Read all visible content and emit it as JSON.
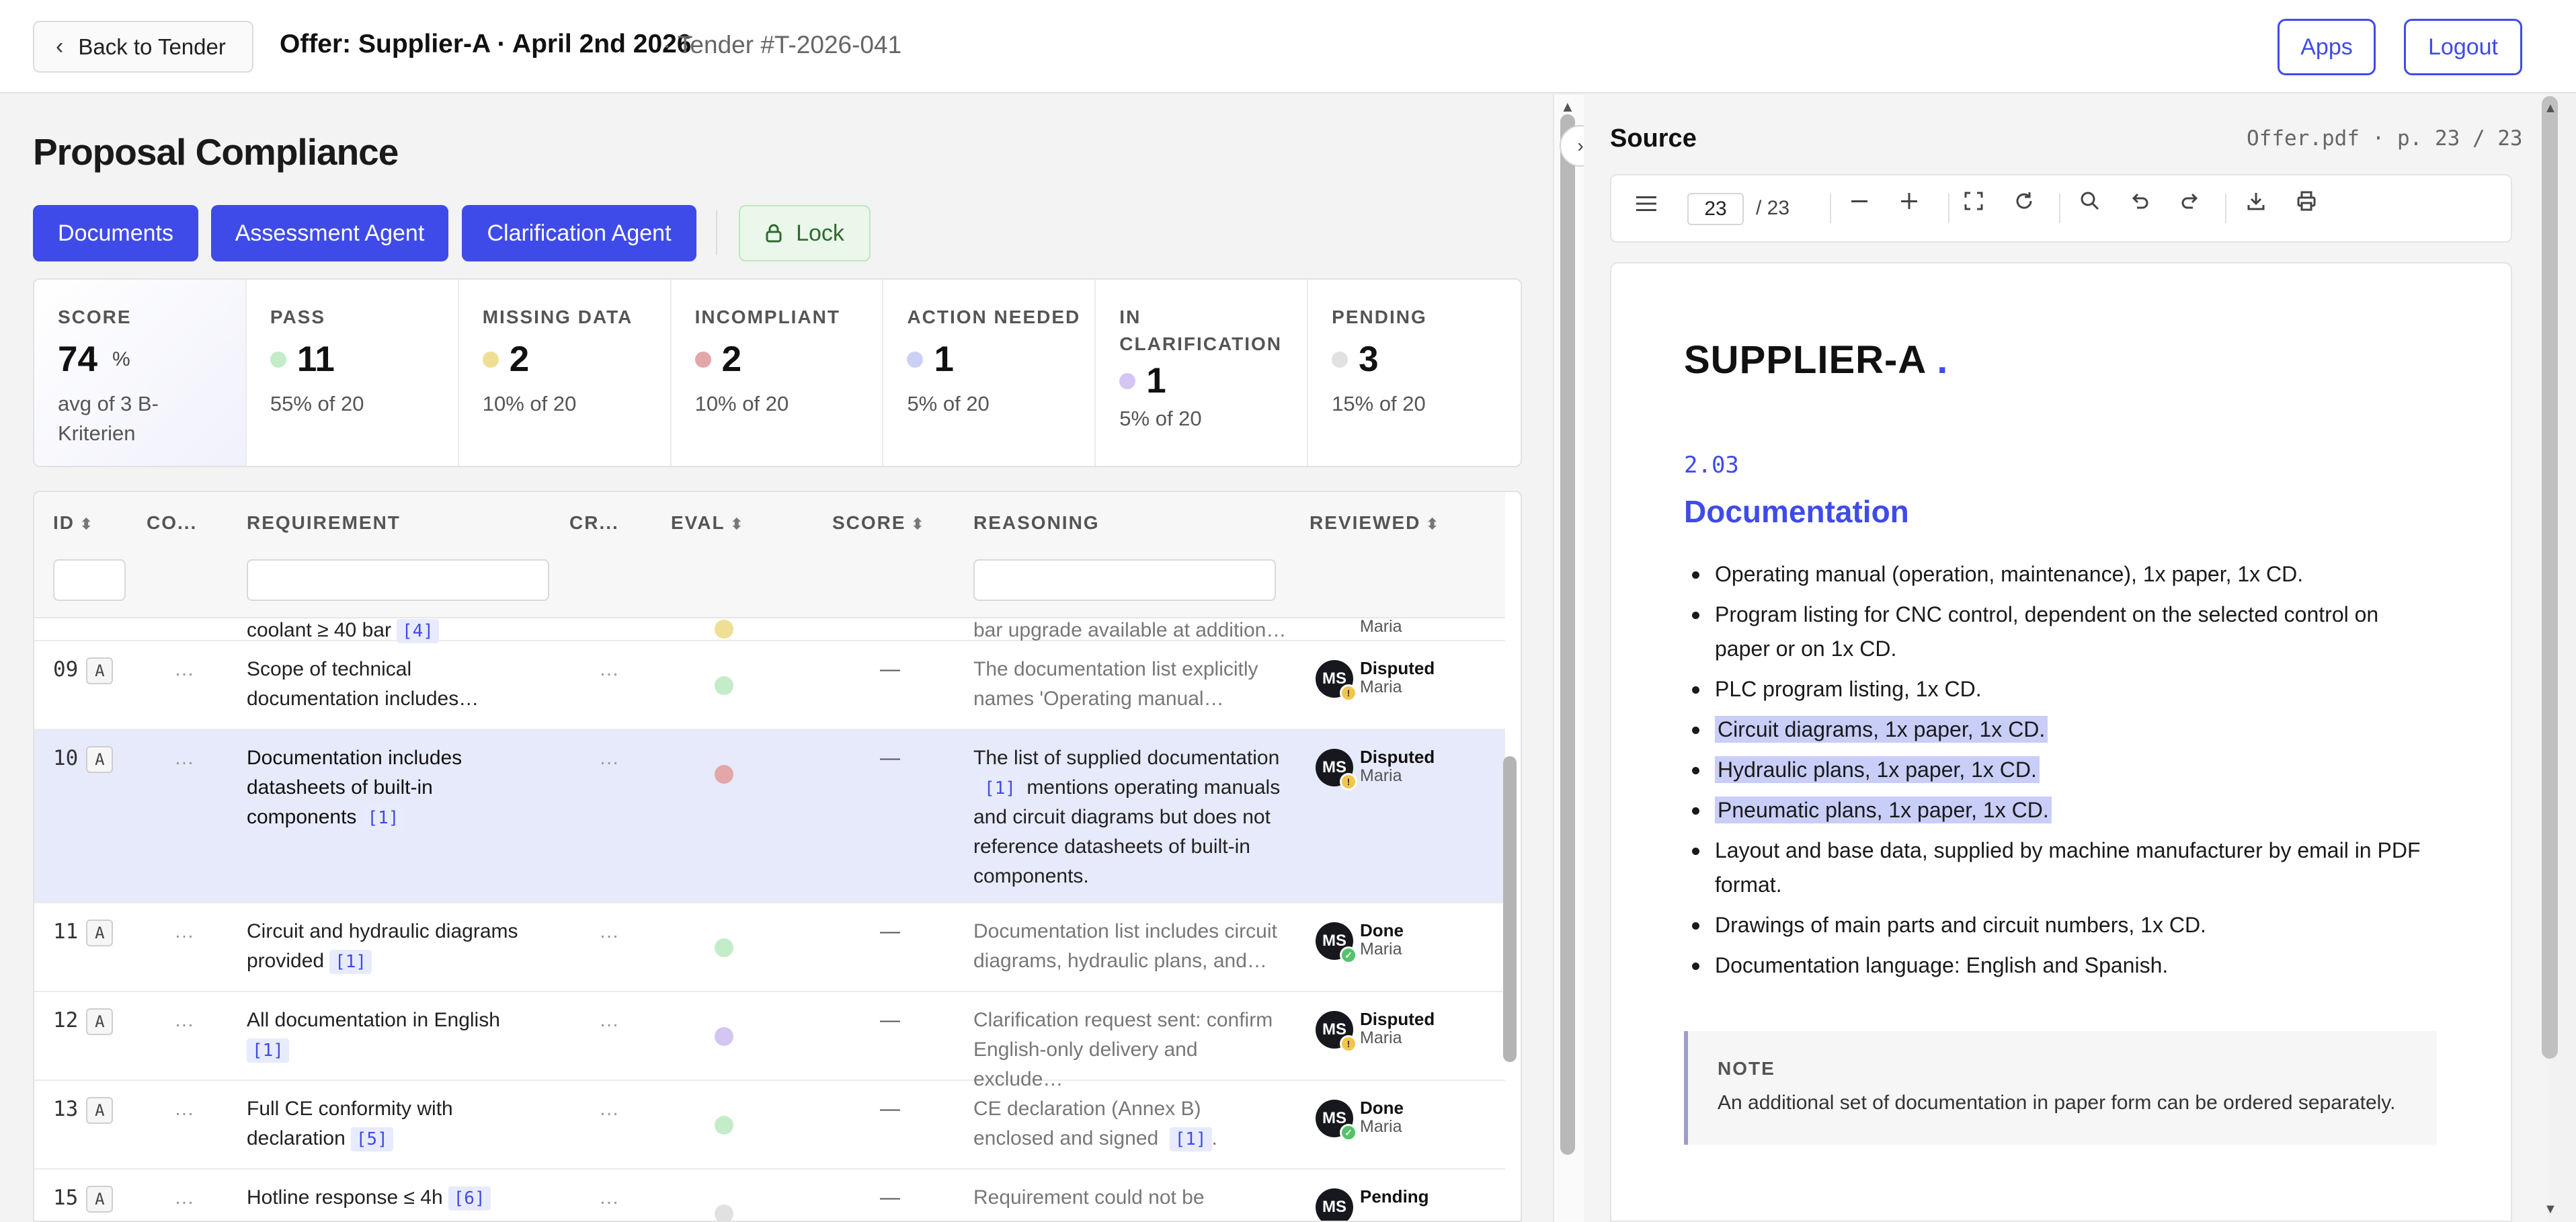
{
  "topbar": {
    "back_label": "Back to Tender",
    "offer_title": "Offer: Supplier-A · April 2nd 2026",
    "tender_id": "· Tender #T-2026-041",
    "apps_label": "Apps",
    "logout_label": "Logout"
  },
  "page_title": "Proposal Compliance",
  "actions": {
    "documents": "Documents",
    "assessment": "Assessment Agent",
    "clarification": "Clarification Agent",
    "lock": "Lock"
  },
  "stats": [
    {
      "label": "SCORE",
      "value": "74",
      "unit": "%",
      "sub": "avg of 3 B-Kriterien",
      "color": ""
    },
    {
      "label": "PASS",
      "value": "11",
      "sub": "55% of 20",
      "color": "#c4ecc9"
    },
    {
      "label": "MISSING DATA",
      "value": "2",
      "sub": "10% of 20",
      "color": "#efdf95"
    },
    {
      "label": "INCOMPLIANT",
      "value": "2",
      "sub": "10% of 20",
      "color": "#e3a7a7"
    },
    {
      "label": "ACTION NEEDED",
      "value": "1",
      "sub": "5% of 20",
      "color": "#ccd0f5"
    },
    {
      "label": "IN CLARIFICATION",
      "value": "1",
      "sub": "5% of 20",
      "color": "#d4c6f2"
    },
    {
      "label": "PENDING",
      "value": "3",
      "sub": "15% of 20",
      "color": "#e1e1e1"
    }
  ],
  "table": {
    "headers": {
      "id": "ID",
      "co": "CO...",
      "requirement": "REQUIREMENT",
      "cr": "CR...",
      "eval": "EVAL",
      "score": "SCORE",
      "reasoning": "REASONING",
      "reviewed": "REVIEWED"
    },
    "partial_row": {
      "req": "coolant ≥ 40 bar",
      "req_ref": "[4]",
      "reason": "bar upgrade available at addition…",
      "who": "Maria"
    },
    "rows": [
      {
        "id": "09",
        "badge": "A",
        "co": "…",
        "req": "Scope of technical documentation includes…",
        "ref": "",
        "cr": "…",
        "eval": "#c4ecc9",
        "score": "—",
        "reason": "The documentation list explicitly names 'Operating manual…",
        "reason_ref": "",
        "status": "Disputed",
        "who": "Maria",
        "initials": "MS",
        "mini": "warn"
      },
      {
        "id": "10",
        "badge": "A",
        "co": "…",
        "req": "Documentation includes datasheets of built-in components",
        "ref": "[1]",
        "cr": "…",
        "eval": "#e3a7a7",
        "score": "—",
        "reason_pre": "The list of supplied documentation",
        "reason_ref": "[1]",
        "reason_post": "mentions operating manuals and circuit diagrams but does not reference datasheets of built-in components.",
        "status": "Disputed",
        "who": "Maria",
        "initials": "MS",
        "mini": "warn"
      },
      {
        "id": "11",
        "badge": "A",
        "co": "…",
        "req": "Circuit and hydraulic diagrams provided",
        "ref": "[1]",
        "cr": "…",
        "eval": "#c4ecc9",
        "score": "—",
        "reason": "Documentation list includes circuit diagrams, hydraulic plans, and…",
        "status": "Done",
        "who": "Maria",
        "initials": "MS",
        "mini": "ok"
      },
      {
        "id": "12",
        "badge": "A",
        "co": "…",
        "req": "All documentation in English",
        "ref": "[1]",
        "cr": "…",
        "eval": "#d4c6f2",
        "score": "—",
        "reason": "Clarification request sent: confirm English-only delivery and exclude…",
        "status": "Disputed",
        "who": "Maria",
        "initials": "MS",
        "mini": "warn"
      },
      {
        "id": "13",
        "badge": "A",
        "co": "…",
        "req": "Full CE conformity with declaration",
        "ref": "[5]",
        "cr": "…",
        "eval": "#c4ecc9",
        "score": "—",
        "reason_pre": "CE declaration (Annex B) enclosed and signed",
        "reason_ref": "[1]",
        "reason_post": ".",
        "status": "Done",
        "who": "Maria",
        "initials": "MS",
        "mini": "ok"
      },
      {
        "id": "15",
        "badge": "A",
        "co": "…",
        "req": "Hotline response ≤ 4h",
        "ref": "[6]",
        "cr": "…",
        "eval": "#e1e1e1",
        "score": "—",
        "reason": "Requirement could not be",
        "status": "Pending",
        "who": "",
        "initials": "MS",
        "mini": ""
      }
    ]
  },
  "source": {
    "title": "Source",
    "file": "Offer.pdf · p. 23 / 23",
    "page_current": "23",
    "page_total": "/ 23",
    "doc_heading": "SUPPLIER-A",
    "doc_heading_dot": ".",
    "section_number": "2.03",
    "section_title": "Documentation",
    "items": [
      "Operating manual (operation, maintenance), 1x paper, 1x CD.",
      "Program listing for CNC control, dependent on the selected control on paper or on 1x CD.",
      "PLC program listing, 1x CD.",
      "Circuit diagrams, 1x paper, 1x CD.",
      "Hydraulic plans, 1x paper, 1x CD.",
      "Pneumatic plans, 1x paper, 1x CD.",
      "Layout and base data, supplied by machine manufacturer by email in PDF format.",
      "Drawings of main parts and circuit numbers, 1x CD.",
      "Documentation language: English and Spanish."
    ],
    "note_label": "NOTE",
    "note_text": "An additional set of documentation in paper form can be ordered separately."
  }
}
